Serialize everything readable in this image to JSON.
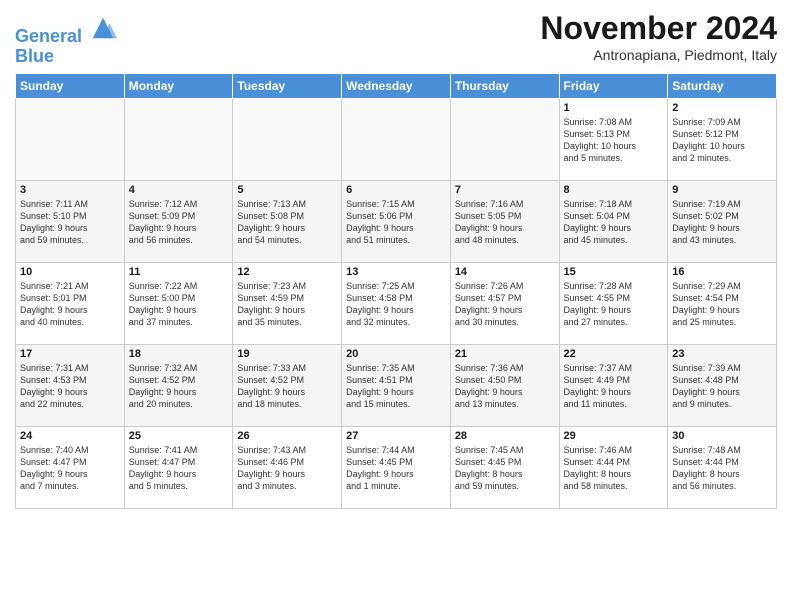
{
  "header": {
    "logo_line1": "General",
    "logo_line2": "Blue",
    "month": "November 2024",
    "location": "Antronapiana, Piedmont, Italy"
  },
  "days_of_week": [
    "Sunday",
    "Monday",
    "Tuesday",
    "Wednesday",
    "Thursday",
    "Friday",
    "Saturday"
  ],
  "weeks": [
    [
      {
        "day": "",
        "info": ""
      },
      {
        "day": "",
        "info": ""
      },
      {
        "day": "",
        "info": ""
      },
      {
        "day": "",
        "info": ""
      },
      {
        "day": "",
        "info": ""
      },
      {
        "day": "1",
        "info": "Sunrise: 7:08 AM\nSunset: 5:13 PM\nDaylight: 10 hours\nand 5 minutes."
      },
      {
        "day": "2",
        "info": "Sunrise: 7:09 AM\nSunset: 5:12 PM\nDaylight: 10 hours\nand 2 minutes."
      }
    ],
    [
      {
        "day": "3",
        "info": "Sunrise: 7:11 AM\nSunset: 5:10 PM\nDaylight: 9 hours\nand 59 minutes."
      },
      {
        "day": "4",
        "info": "Sunrise: 7:12 AM\nSunset: 5:09 PM\nDaylight: 9 hours\nand 56 minutes."
      },
      {
        "day": "5",
        "info": "Sunrise: 7:13 AM\nSunset: 5:08 PM\nDaylight: 9 hours\nand 54 minutes."
      },
      {
        "day": "6",
        "info": "Sunrise: 7:15 AM\nSunset: 5:06 PM\nDaylight: 9 hours\nand 51 minutes."
      },
      {
        "day": "7",
        "info": "Sunrise: 7:16 AM\nSunset: 5:05 PM\nDaylight: 9 hours\nand 48 minutes."
      },
      {
        "day": "8",
        "info": "Sunrise: 7:18 AM\nSunset: 5:04 PM\nDaylight: 9 hours\nand 45 minutes."
      },
      {
        "day": "9",
        "info": "Sunrise: 7:19 AM\nSunset: 5:02 PM\nDaylight: 9 hours\nand 43 minutes."
      }
    ],
    [
      {
        "day": "10",
        "info": "Sunrise: 7:21 AM\nSunset: 5:01 PM\nDaylight: 9 hours\nand 40 minutes."
      },
      {
        "day": "11",
        "info": "Sunrise: 7:22 AM\nSunset: 5:00 PM\nDaylight: 9 hours\nand 37 minutes."
      },
      {
        "day": "12",
        "info": "Sunrise: 7:23 AM\nSunset: 4:59 PM\nDaylight: 9 hours\nand 35 minutes."
      },
      {
        "day": "13",
        "info": "Sunrise: 7:25 AM\nSunset: 4:58 PM\nDaylight: 9 hours\nand 32 minutes."
      },
      {
        "day": "14",
        "info": "Sunrise: 7:26 AM\nSunset: 4:57 PM\nDaylight: 9 hours\nand 30 minutes."
      },
      {
        "day": "15",
        "info": "Sunrise: 7:28 AM\nSunset: 4:55 PM\nDaylight: 9 hours\nand 27 minutes."
      },
      {
        "day": "16",
        "info": "Sunrise: 7:29 AM\nSunset: 4:54 PM\nDaylight: 9 hours\nand 25 minutes."
      }
    ],
    [
      {
        "day": "17",
        "info": "Sunrise: 7:31 AM\nSunset: 4:53 PM\nDaylight: 9 hours\nand 22 minutes."
      },
      {
        "day": "18",
        "info": "Sunrise: 7:32 AM\nSunset: 4:52 PM\nDaylight: 9 hours\nand 20 minutes."
      },
      {
        "day": "19",
        "info": "Sunrise: 7:33 AM\nSunset: 4:52 PM\nDaylight: 9 hours\nand 18 minutes."
      },
      {
        "day": "20",
        "info": "Sunrise: 7:35 AM\nSunset: 4:51 PM\nDaylight: 9 hours\nand 15 minutes."
      },
      {
        "day": "21",
        "info": "Sunrise: 7:36 AM\nSunset: 4:50 PM\nDaylight: 9 hours\nand 13 minutes."
      },
      {
        "day": "22",
        "info": "Sunrise: 7:37 AM\nSunset: 4:49 PM\nDaylight: 9 hours\nand 11 minutes."
      },
      {
        "day": "23",
        "info": "Sunrise: 7:39 AM\nSunset: 4:48 PM\nDaylight: 9 hours\nand 9 minutes."
      }
    ],
    [
      {
        "day": "24",
        "info": "Sunrise: 7:40 AM\nSunset: 4:47 PM\nDaylight: 9 hours\nand 7 minutes."
      },
      {
        "day": "25",
        "info": "Sunrise: 7:41 AM\nSunset: 4:47 PM\nDaylight: 9 hours\nand 5 minutes."
      },
      {
        "day": "26",
        "info": "Sunrise: 7:43 AM\nSunset: 4:46 PM\nDaylight: 9 hours\nand 3 minutes."
      },
      {
        "day": "27",
        "info": "Sunrise: 7:44 AM\nSunset: 4:45 PM\nDaylight: 9 hours\nand 1 minute."
      },
      {
        "day": "28",
        "info": "Sunrise: 7:45 AM\nSunset: 4:45 PM\nDaylight: 8 hours\nand 59 minutes."
      },
      {
        "day": "29",
        "info": "Sunrise: 7:46 AM\nSunset: 4:44 PM\nDaylight: 8 hours\nand 58 minutes."
      },
      {
        "day": "30",
        "info": "Sunrise: 7:48 AM\nSunset: 4:44 PM\nDaylight: 8 hours\nand 56 minutes."
      }
    ]
  ]
}
